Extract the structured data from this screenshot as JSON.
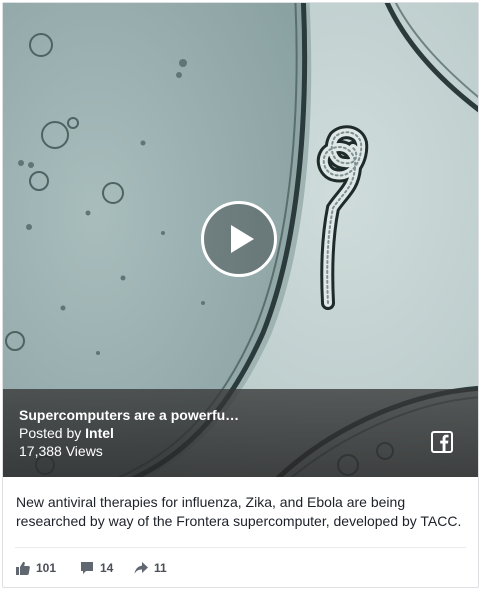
{
  "video": {
    "title": "Supercomputers are a powerfu…",
    "posted_prefix": "Posted by",
    "author": "Intel",
    "views": "17,388 Views",
    "play_icon": "play-icon",
    "share_icon": "facebook-icon"
  },
  "post": {
    "description": "New antiviral therapies for influenza, Zika, and Ebola are being researched by way of the Frontera supercomputer, developed by TACC."
  },
  "stats": {
    "likes": "101",
    "comments": "14",
    "shares": "11"
  },
  "colors": {
    "text": "#1d2129",
    "secondary_text": "#4b4f56",
    "border": "#dddfe2"
  }
}
